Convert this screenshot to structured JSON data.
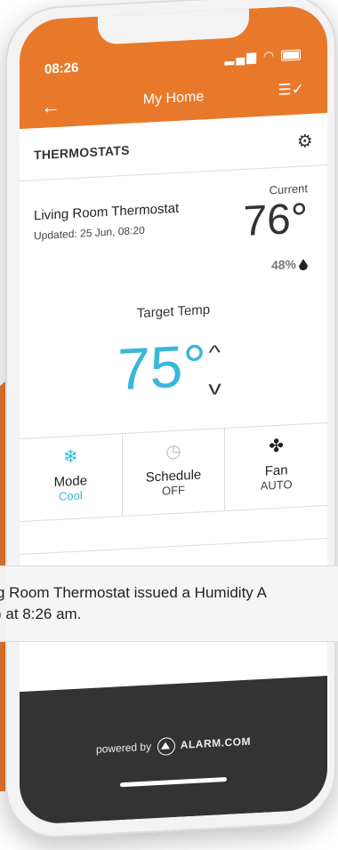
{
  "status_bar": {
    "time": "08:26",
    "signal": "..ıl",
    "wifi": "≋"
  },
  "header": {
    "title": "My Home"
  },
  "section": {
    "title": "THERMOSTATS"
  },
  "thermostat": {
    "name": "Living Room Thermostat",
    "updated": "Updated: 25 Jun, 08:20",
    "current_label": "Current",
    "current_temp": "76°",
    "humidity": "48%",
    "target_label": "Target Temp",
    "target_temp": "75°"
  },
  "controls": [
    {
      "label": "Mode",
      "value": "Cool",
      "icon": "snowflake-icon"
    },
    {
      "label": "Schedule",
      "value": "OFF",
      "icon": "clock-icon"
    },
    {
      "label": "Fan",
      "value": "AUTO",
      "icon": "fan-icon"
    }
  ],
  "notification": {
    "line1": "g Room Thermostat issued a Humidity A",
    "line2": ") at 8:26 am."
  },
  "footer": {
    "powered_by": "powered by",
    "brand": "ALARM.COM"
  },
  "colors": {
    "accent": "#e8792b",
    "target": "#39b8d8",
    "footer": "#333333"
  }
}
